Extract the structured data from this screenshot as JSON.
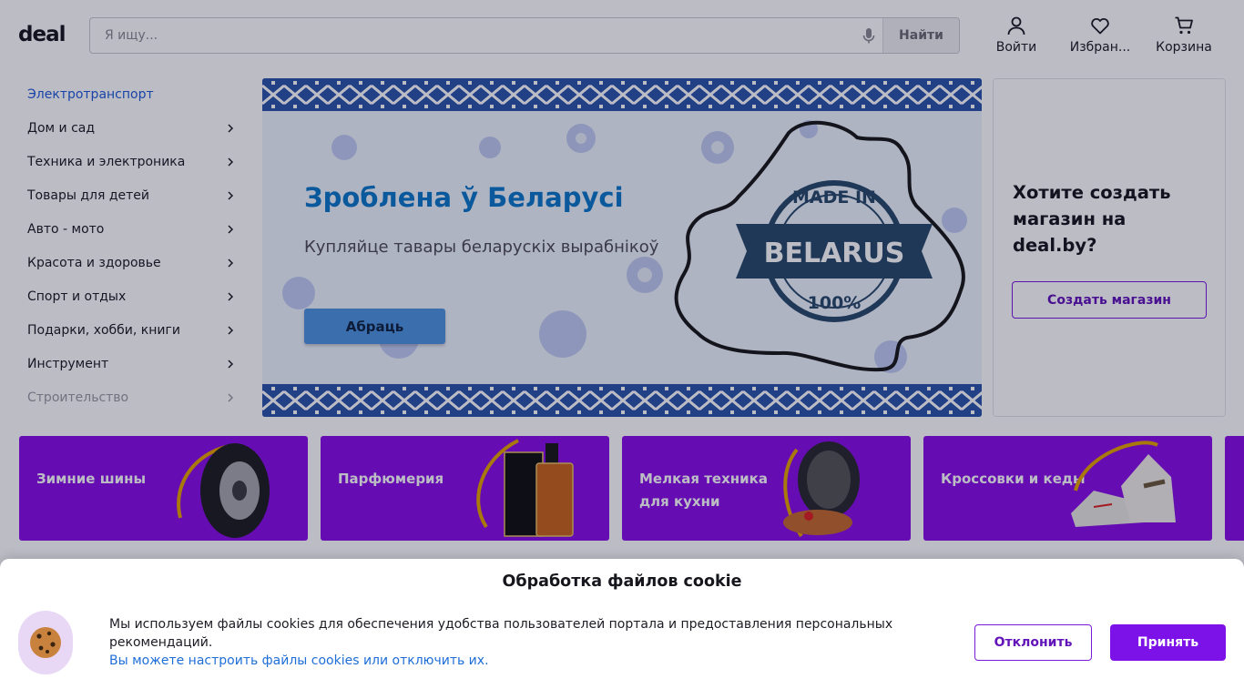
{
  "header": {
    "logo": "deal",
    "search": {
      "placeholder": "Я ищу...",
      "button": "Найти"
    },
    "actions": [
      {
        "label": "Войти",
        "icon": "user-icon"
      },
      {
        "label": "Избран...",
        "icon": "heart-icon"
      },
      {
        "label": "Корзина",
        "icon": "cart-icon"
      }
    ]
  },
  "sidebar": {
    "items": [
      {
        "label": "Электротранспорт",
        "has_arrow": false,
        "state": "highlighted"
      },
      {
        "label": "Дом и сад",
        "has_arrow": true
      },
      {
        "label": "Техника и электроника",
        "has_arrow": true
      },
      {
        "label": "Товары для детей",
        "has_arrow": true
      },
      {
        "label": "Авто - мото",
        "has_arrow": true
      },
      {
        "label": "Красота и здоровье",
        "has_arrow": true
      },
      {
        "label": "Спорт и отдых",
        "has_arrow": true
      },
      {
        "label": "Подарки, хобби, книги",
        "has_arrow": true
      },
      {
        "label": "Инструмент",
        "has_arrow": true
      },
      {
        "label": "Строительство",
        "has_arrow": true,
        "state": "faded"
      }
    ]
  },
  "banner": {
    "title": "Зроблена ў Беларусі",
    "subtitle": "Купляйце тавары беларускіх вырабнікоў",
    "button": "Абраць",
    "badge": {
      "top": "MADE IN",
      "middle": "BELARUS",
      "bottom": "100%"
    }
  },
  "promo_card": {
    "title": "Хотите создать магазин на deal.by?",
    "button": "Создать магазин"
  },
  "tiles": [
    {
      "label": "Зимние шины",
      "image": "tire"
    },
    {
      "label": "Парфюмерия",
      "image": "perfume"
    },
    {
      "label": "Мелкая техника для кухни",
      "image": "waffle-maker"
    },
    {
      "label": "Кроссовки и кеды",
      "image": "sneakers"
    }
  ],
  "cookie": {
    "title": "Обработка файлов cookie",
    "text": "Мы используем файлы cookies для обеспечения удобства пользователей портала и предоставления персональных рекомендаций.",
    "link": "Вы можете настроить файлы cookies или отключить их.",
    "decline": "Отклонить",
    "accept": "Принять"
  },
  "colors": {
    "brand": "#7c11e8",
    "tile_bg": "#8a0fe6",
    "link": "#1e6ed8",
    "banner_blue": "#0d78c8",
    "overlay": "rgba(8, 8, 40, 0.27)"
  }
}
